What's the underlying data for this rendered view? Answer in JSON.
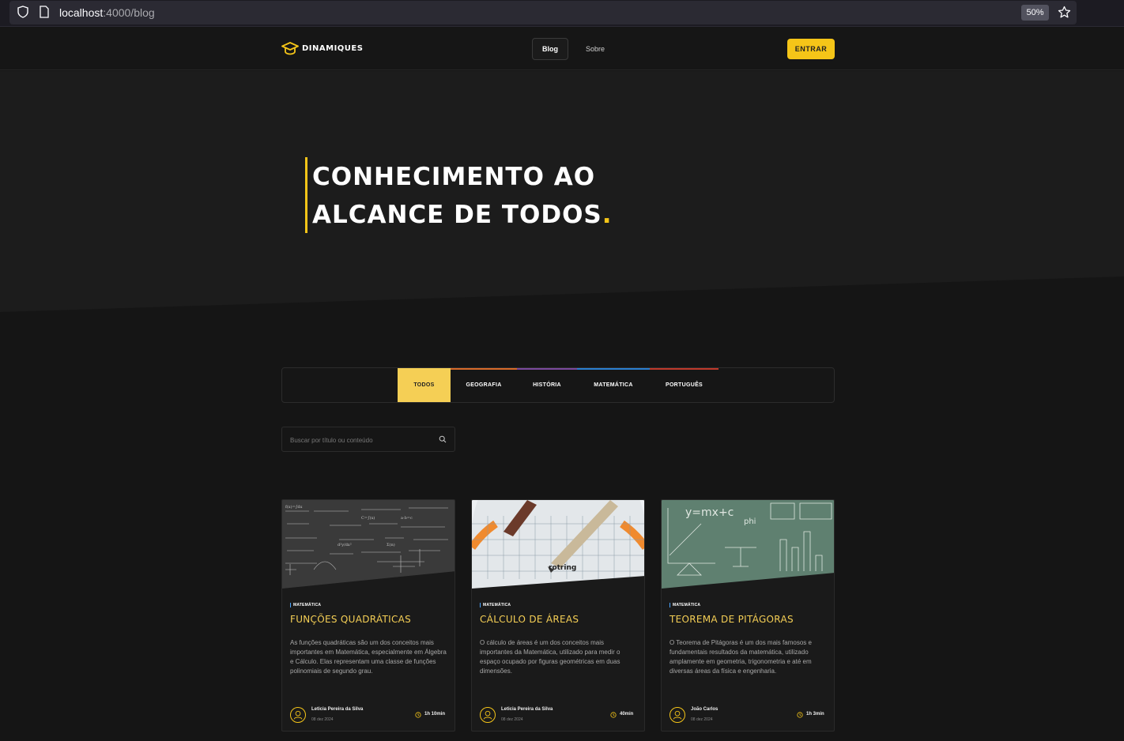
{
  "browser": {
    "url_host": "localhost",
    "url_path": ":4000/blog",
    "zoom": "50%"
  },
  "header": {
    "logo_text": "DINAMIQUES",
    "nav": [
      {
        "label": "Blog"
      },
      {
        "label": "Sobre"
      }
    ],
    "cta_label": "ENTRAR"
  },
  "hero": {
    "title_line1": "CONHECIMENTO AO",
    "title_line2": "ALCANCE DE TODOS",
    "title_dot": "."
  },
  "categories": [
    {
      "label": "TODOS",
      "active": true,
      "color": "#f5cf55"
    },
    {
      "label": "GEOGRAFIA",
      "active": false,
      "color": "#d86a2a"
    },
    {
      "label": "HISTÓRIA",
      "active": false,
      "color": "#7b4a9e"
    },
    {
      "label": "MATEMÁTICA",
      "active": false,
      "color": "#2b7fd1"
    },
    {
      "label": "PORTUGUÊS",
      "active": false,
      "color": "#c0392b"
    }
  ],
  "search": {
    "placeholder": "Buscar por título ou conteúdo"
  },
  "posts": [
    {
      "tag": "MATEMÁTICA",
      "title": "FUNÇÕES QUADRÁTICAS",
      "description": "As funções quadráticas são um dos conceitos mais importantes em Matemática, especialmente em Álgebra e Cálculo. Elas representam uma classe de funções polinomiais de segundo grau.",
      "author": "Leticia Pereira da Silva",
      "date": "08 dez 2024",
      "reading_time": "1h 10min"
    },
    {
      "tag": "MATEMÁTICA",
      "title": "CÁLCULO DE ÁREAS",
      "description": "O cálculo de áreas é um dos conceitos mais importantes da Matemática, utilizado para medir o espaço ocupado por figuras geométricas em duas dimensões.",
      "author": "Leticia Pereira da Silva",
      "date": "08 dez 2024",
      "reading_time": "40min"
    },
    {
      "tag": "MATEMÁTICA",
      "title": "TEOREMA DE PITÁGORAS",
      "description": "O Teorema de Pitágoras é um dos mais famosos e fundamentais resultados da matemática, utilizado amplamente em geometria, trigonometria e até em diversas áreas da física e engenharia.",
      "author": "João Carlos",
      "date": "08 dez 2024",
      "reading_time": "1h 3min"
    }
  ],
  "colors": {
    "accent": "#f5c518",
    "background": "#151515",
    "hero_background": "#1c1c1c"
  }
}
